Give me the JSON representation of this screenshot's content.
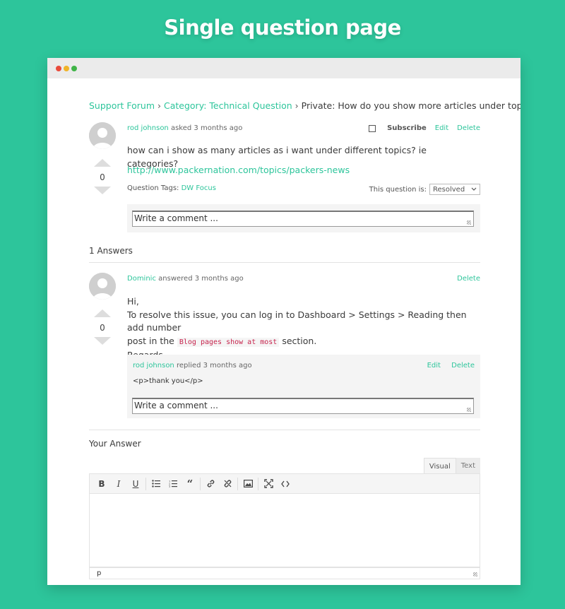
{
  "headline": "Single question page",
  "breadcrumb": {
    "forum": "Support Forum",
    "sep": "›",
    "category": "Category: Technical Question",
    "current": "Private: How do you show more articles under topics"
  },
  "question": {
    "author": "rod johnson",
    "asked": "asked 3 months ago",
    "subscribe": "Subscribe",
    "edit": "Edit",
    "delete": "Delete",
    "votes": "0",
    "text": "how can i show as many articles as i want under different topics? ie categories?",
    "url": "http://www.packernation.com/topics/packers-news",
    "tags_label": "Question Tags:",
    "tag": "DW Focus",
    "status_label": "This question is:",
    "status_value": "Resolved",
    "comment_placeholder": "Write a comment ..."
  },
  "answers_count": "1 Answers",
  "answer": {
    "author": "Dominic",
    "answered": "answered 3 months ago",
    "delete": "Delete",
    "votes": "0",
    "line1": "Hi,",
    "line2": "To resolve this issue, you can log in to Dashboard > Settings > Reading then add number",
    "line3_pre": "post in the",
    "line3_code": "Blog pages show at most",
    "line3_post": "section.",
    "line4": "Regards,",
    "reply": {
      "author": "rod johnson",
      "replied": "replied 3 months ago",
      "edit": "Edit",
      "delete": "Delete",
      "text": "<p>thank you</p>",
      "comment_placeholder": "Write a comment ..."
    }
  },
  "your_answer": {
    "title": "Your Answer",
    "tab_visual": "Visual",
    "tab_text": "Text",
    "status_path": "p",
    "toolbar": [
      "B",
      "I",
      "U",
      "bullet-list",
      "numbered-list",
      "quote",
      "link",
      "unlink",
      "image",
      "fullscreen",
      "code"
    ]
  },
  "colors": {
    "background": "#2dc59b",
    "link": "#2dc59b",
    "code": "#c7254e"
  }
}
